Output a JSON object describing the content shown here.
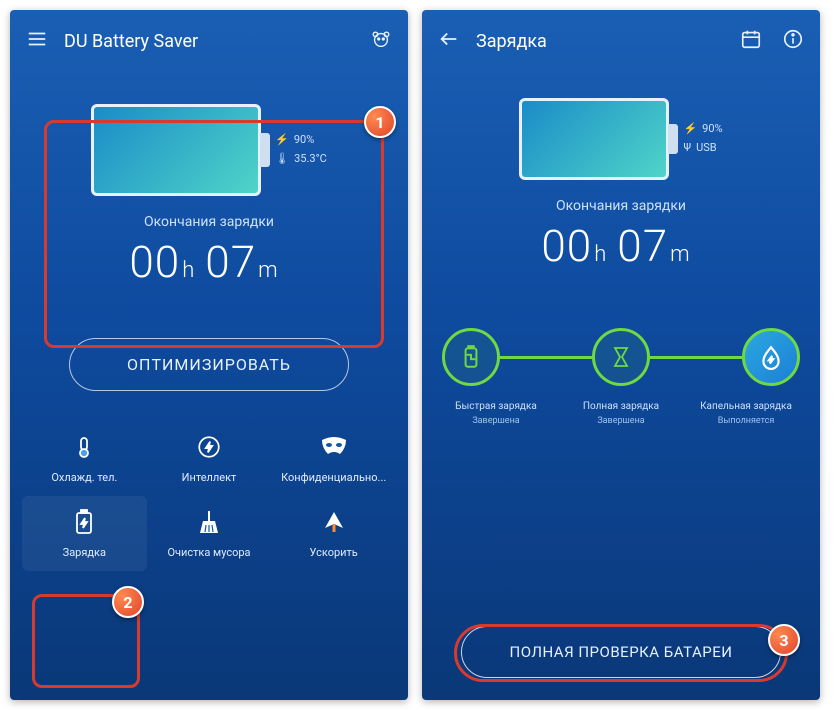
{
  "left": {
    "title": "DU Battery Saver",
    "battery_pct": "90%",
    "battery_temp": "35.3°C",
    "charge_label": "Окончания зарядки",
    "time_h": "00",
    "time_h_unit": "h",
    "time_m": "07",
    "time_m_unit": "m",
    "optimize": "ОПТИМИЗИРОВАТЬ",
    "grid": [
      {
        "label": "Охлажд. тел."
      },
      {
        "label": "Интеллект"
      },
      {
        "label": "Конфиденциально..."
      },
      {
        "label": "Зарядка"
      },
      {
        "label": "Очистка мусора"
      },
      {
        "label": "Ускорить"
      }
    ]
  },
  "right": {
    "title": "Зарядка",
    "battery_pct": "90%",
    "battery_src": "USB",
    "charge_label": "Окончания зарядки",
    "time_h": "00",
    "time_h_unit": "h",
    "time_m": "07",
    "time_m_unit": "m",
    "stages": [
      {
        "t": "Быстрая зарядка",
        "s": "Завершена"
      },
      {
        "t": "Полная зарядка",
        "s": "Завершена"
      },
      {
        "t": "Капельная зарядка",
        "s": "Выполняется"
      }
    ],
    "full_check": "ПОЛНАЯ ПРОВЕРКА БАТАРЕИ"
  },
  "annotations": [
    "1",
    "2",
    "3"
  ]
}
